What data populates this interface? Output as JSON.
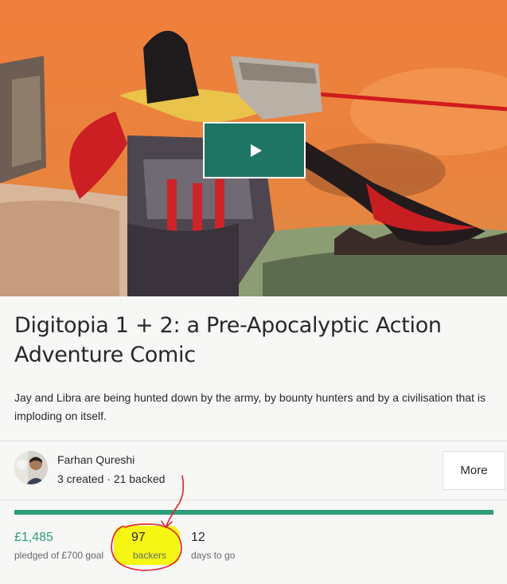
{
  "project": {
    "title": "Digitopia 1 + 2: a Pre-Apocalyptic Action Adventure Comic",
    "blurb": "Jay and Libra are being hunted down by the army, by bounty hunters and by a civilisation that is imploding on itself."
  },
  "video": {
    "play_icon": "play-icon"
  },
  "creator": {
    "name": "Farhan Qureshi",
    "stats": "3 created · 21 backed",
    "more_label": "More"
  },
  "funding": {
    "progress_percent": 100,
    "pledged_value": "£1,485",
    "pledged_label": "pledged of £700 goal",
    "backers_value": "97",
    "backers_label": "backers",
    "days_value": "12",
    "days_label": "days to go"
  },
  "colors": {
    "accent_green": "#2e9d78",
    "play_button": "#1f7563",
    "highlight": "#f4f500",
    "annotation_red": "#e0202a"
  }
}
